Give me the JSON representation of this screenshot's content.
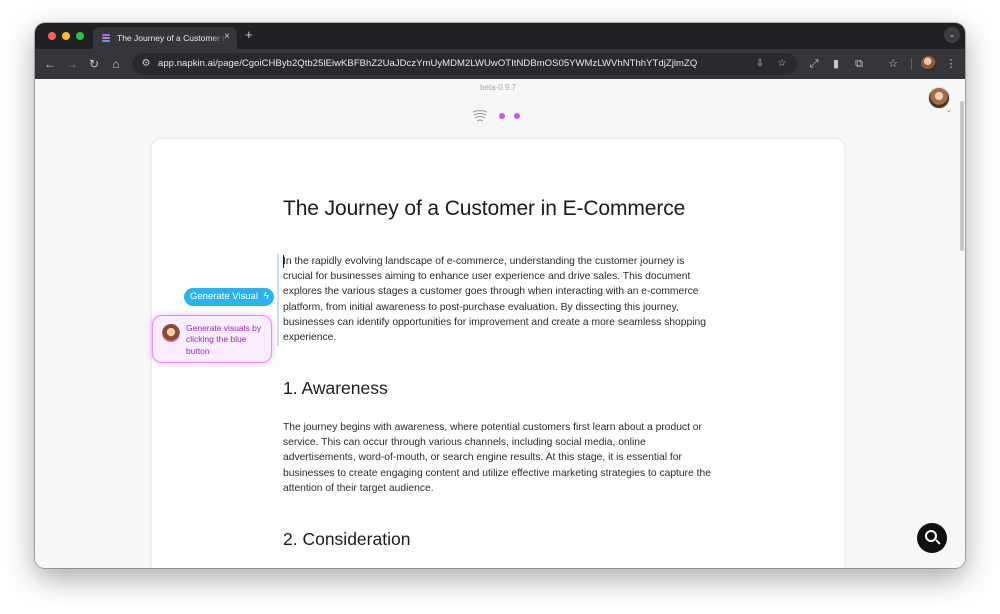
{
  "browser": {
    "tab_title": "The Journey of a Customer in E-Commerce",
    "url": "app.napkin.ai/page/CgoiCHByb2Qtb25lEiwKBFBhZ2UaJDczYmUyMDM2LWUwOTItNDBmOS05YWMzLWVhNThhYTdjZjlmZQ",
    "new_tab_glyph": "+",
    "close_glyph": "×"
  },
  "app": {
    "version": "beta-0.9.7",
    "accent_color": "#29b4f0",
    "dot_color": "#c659ec"
  },
  "document": {
    "title": "The Journey of a Customer in E-Commerce",
    "intro": "In the rapidly evolving landscape of e-commerce, understanding the customer journey is crucial for businesses aiming to enhance user experience and drive sales. This document explores the various stages a customer goes through when interacting with an e-commerce platform, from initial awareness to post-purchase evaluation. By dissecting this journey, businesses can identify opportunities for improvement and create a more seamless shopping experience.",
    "section1_heading": "1. Awareness",
    "section1_body": "The journey begins with awareness, where potential customers first learn about a product or service. This can occur through various channels, including social media, online advertisements, word-of-mouth, or search engine results. At this stage, it is essential for businesses to create engaging content and utilize effective marketing strategies to capture the attention of their target audience.",
    "section2_heading": "2. Consideration"
  },
  "generate": {
    "button_label": "Generate Visual",
    "tooltip_text": "Generate visuals by clicking the blue button"
  },
  "icons": {
    "back": "arrow-left-icon",
    "forward": "arrow-right-icon",
    "reload": "reload-icon",
    "home": "home-icon",
    "search_fab": "search-icon"
  }
}
